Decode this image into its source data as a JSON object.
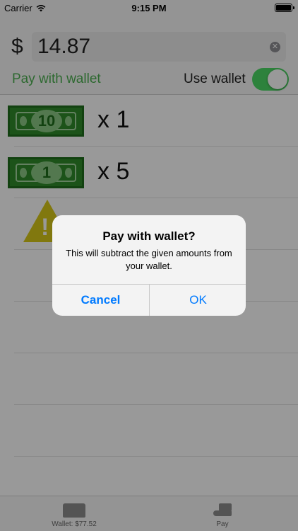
{
  "status_bar": {
    "carrier": "Carrier",
    "time": "9:15 PM"
  },
  "header": {
    "currency_symbol": "$",
    "amount": "14.87",
    "pay_with_wallet_label": "Pay with wallet",
    "use_wallet_label": "Use wallet",
    "use_wallet_enabled": true
  },
  "bills": [
    {
      "denomination": "10",
      "count": "x 1"
    },
    {
      "denomination": "1",
      "count": "x 5"
    }
  ],
  "alert": {
    "title": "Pay with wallet?",
    "message": "This will subtract the given amounts from your wallet.",
    "cancel_label": "Cancel",
    "ok_label": "OK"
  },
  "tabbar": {
    "wallet_label": "Wallet: $77.52",
    "pay_label": "Pay"
  },
  "colors": {
    "accent_green": "#4caf50",
    "toggle_on": "#4cd964",
    "bill_green": "#2f8a2b",
    "alert_button": "#007aff"
  },
  "icons": [
    "wifi-icon",
    "battery-icon",
    "clear-icon",
    "bill-icon",
    "warning-icon",
    "wallet-icon",
    "pay-icon"
  ]
}
